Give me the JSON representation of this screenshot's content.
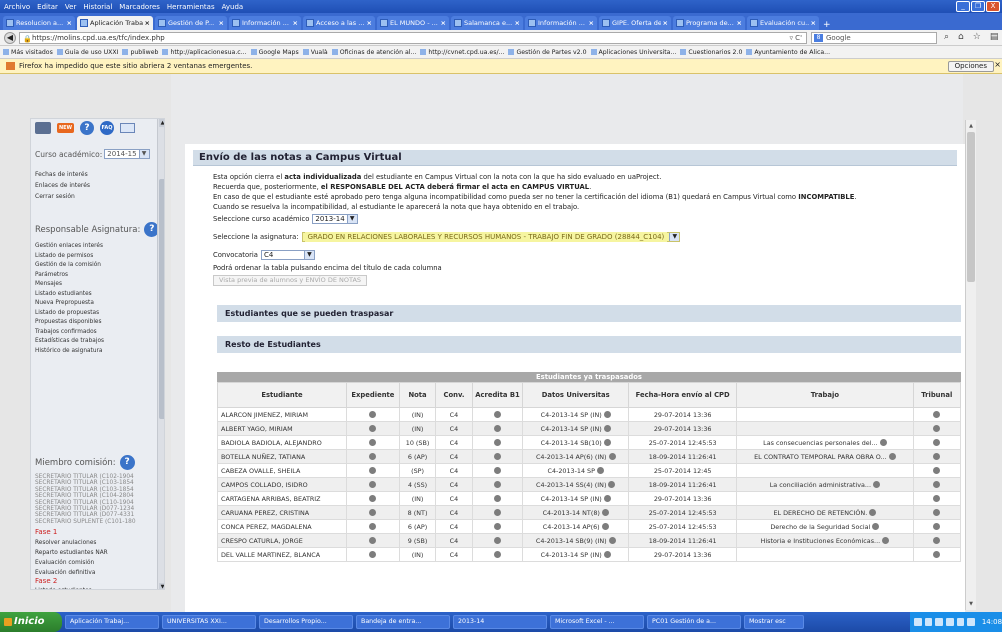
{
  "menubar": {
    "items": [
      "Archivo",
      "Editar",
      "Ver",
      "Historial",
      "Marcadores",
      "Herramientas",
      "Ayuda"
    ],
    "controls": [
      "_",
      "❐",
      "X"
    ]
  },
  "tabs": [
    "Resolucion a...",
    "Aplicación Trabaj...",
    "Gestión de P...",
    "Información ...",
    "Acceso a las ...",
    "EL MUNDO - ...",
    "Salamanca e...",
    "Información ...",
    "GIPE. Oferta de E...",
    "Programa de...",
    "Evaluación cu..."
  ],
  "urlbar": {
    "url": "https://molins.cpd.ua.es/tfc/index.php",
    "search": "Google",
    "reload": "▿ C'"
  },
  "bookmarks": [
    "Más visitados",
    "Guía de uso UXXI",
    "publiweb",
    "http://aplicacionesua.c...",
    "Google Maps",
    "Vualà",
    "Oficinas de atención al...",
    "http://cvnet.cpd.ua.es/...",
    "Gestión de Partes v2.0",
    "Aplicaciones Universita...",
    "Cuestionarios 2.0",
    "Ayuntamiento de Alica..."
  ],
  "notice": {
    "text": "Firefox ha impedido que este sitio abriera 2 ventanas emergentes.",
    "options": "Opciones"
  },
  "sidebar": {
    "icons": {
      "new": "NEW",
      "help": "?",
      "faq": "FAQ"
    },
    "curso_label": "Curso académico:",
    "curso_value": "2014-15",
    "links": [
      "Fechas de interés",
      "Enlaces de interés",
      "Cerrar sesión"
    ],
    "resp_heading": "Responsable Asignatura:",
    "resp_items": [
      "Gestión enlaces interés",
      "Listado de permisos",
      "Gestión de la comisión",
      "Parámetros",
      "Mensajes",
      "Listado estudiantes",
      "Nueva Prepropuesta",
      "Listado de propuestas",
      "Propuestas disponibles",
      "Trabajos confirmados",
      "Estadísticas de trabajos",
      "Histórico de asignatura"
    ],
    "miembro_heading": "Miembro comisión:",
    "secretarios": [
      "SECRETARIO TITULAR (C102-1904",
      "SECRETARIO TITULAR (C103-1854",
      "SECRETARIO TITULAR (C103-1854",
      "SECRETARIO TITULAR (C104-2804",
      "SECRETARIO TITULAR (C110-1904",
      "SECRETARIO TITULAR (D077-1234",
      "SECRETARIO TITULAR (D077-4331",
      "SECRETARIO SUPLENTE (C101-180"
    ],
    "fase1": "Fase 1",
    "fase1_items": [
      "Resolver anulaciones",
      "Reparto estudiantes NAR",
      "Evaluación comisión",
      "Evaluación definitiva"
    ],
    "fase2": "Fase 2",
    "fase2_items": [
      "Listado estudiantes"
    ]
  },
  "main": {
    "title": "Envío de las notas a Campus Virtual",
    "intro": [
      [
        "Esta opción cierra el ",
        "acta individualizada",
        " del estudiante en Campus Virtual con la nota con la que ha sido evaluado en uaProject."
      ],
      [
        "Recuerda que, posteriormente, ",
        "el RESPONSABLE DEL ACTA deberá firmar el acta en CAMPUS VIRTUAL",
        "."
      ],
      [
        "En caso de que el estudiante esté aprobado pero tenga alguna incompatibilidad como pueda ser no tener la certificación del idioma (B1) quedará en Campus Virtual como ",
        "INCOMPATIBLE",
        "."
      ],
      [
        "Cuando se resuelva la incompatibilidad, al estudiante le aparecerá la nota que haya obtenido en el trabajo.",
        "",
        ""
      ]
    ],
    "curso_label": "Seleccione curso académico",
    "curso_value": "2013-14",
    "asignatura_label": "Seleccione la asignatura:",
    "asignatura_value": "GRADO EN RELACIONES LABORALES Y RECURSOS HUMANOS - TRABAJO FIN DE GRADO (28844_C104)",
    "conv_label": "Convocatoria",
    "conv_value": "C4",
    "orden_text": "Podrá ordenar la tabla pulsando encima del título de cada columna",
    "preview_button": "Vista previa de alumnos y ENVÍO DE NOTAS",
    "band1": "Estudiantes que se pueden traspasar",
    "band2": "Resto de Estudiantes",
    "table": {
      "caption": "Estudiantes ya traspasados",
      "headers": [
        "Estudiante",
        "Expediente",
        "Nota",
        "Conv.",
        "Acredita B1",
        "Datos Universitas",
        "Fecha-Hora envío al CPD",
        "Trabajo",
        "Tribunal"
      ],
      "rows": [
        {
          "name": "ALARCON JIMENEZ, MIRIAM",
          "nota": "(IN)",
          "conv": "C4",
          "datos": "C4-2013-14 SP (IN)",
          "fecha": "29-07-2014 13:36",
          "trabajo": ""
        },
        {
          "name": "ALBERT YAGO, MIRIAM",
          "nota": "(IN)",
          "conv": "C4",
          "datos": "C4-2013-14 SP (IN)",
          "fecha": "29-07-2014 13:36",
          "trabajo": ""
        },
        {
          "name": "BADIOLA BADIOLA, ALEJANDRO",
          "nota": "10 (SB)",
          "conv": "C4",
          "datos": "C4-2013-14 SB(10)",
          "fecha": "25-07-2014 12:45:53",
          "trabajo": "Las consecuencias personales del..."
        },
        {
          "name": "BOTELLA NUÑEZ, TATIANA",
          "nota": "6 (AP)",
          "conv": "C4",
          "datos": "C4-2013-14 AP(6) (IN)",
          "fecha": "18-09-2014 11:26:41",
          "trabajo": "EL CONTRATO TEMPORAL PARA OBRA O..."
        },
        {
          "name": "CABEZA OVALLE, SHEILA",
          "nota": "(SP)",
          "conv": "C4",
          "datos": "C4-2013-14 SP",
          "fecha": "25-07-2014 12:45",
          "trabajo": ""
        },
        {
          "name": "CAMPOS COLLADO, ISIDRO",
          "nota": "4 (SS)",
          "conv": "C4",
          "datos": "C4-2013-14 SS(4) (IN)",
          "fecha": "18-09-2014 11:26:41",
          "trabajo": "La conciliación administrativa..."
        },
        {
          "name": "CARTAGENA ARRIBAS, BEATRIZ",
          "nota": "(IN)",
          "conv": "C4",
          "datos": "C4-2013-14 SP (IN)",
          "fecha": "29-07-2014 13:36",
          "trabajo": ""
        },
        {
          "name": "CARUANA PEREZ, CRISTINA",
          "nota": "8 (NT)",
          "conv": "C4",
          "datos": "C4-2013-14 NT(8)",
          "fecha": "25-07-2014 12:45:53",
          "trabajo": "EL DERECHO DE RETENCIÓN."
        },
        {
          "name": "CONCA PEREZ, MAGDALENA",
          "nota": "6 (AP)",
          "conv": "C4",
          "datos": "C4-2013-14 AP(6)",
          "fecha": "25-07-2014 12:45:53",
          "trabajo": "Derecho de la Seguridad Social"
        },
        {
          "name": "CRESPO CATURLA, JORGE",
          "nota": "9 (SB)",
          "conv": "C4",
          "datos": "C4-2013-14 SB(9) (IN)",
          "fecha": "18-09-2014 11:26:41",
          "trabajo": "Historia e Instituciones Económicas..."
        },
        {
          "name": "DEL VALLE MARTINEZ, BLANCA",
          "nota": "(IN)",
          "conv": "C4",
          "datos": "C4-2013-14 SP (IN)",
          "fecha": "29-07-2014 13:36",
          "trabajo": ""
        }
      ]
    }
  },
  "taskbar": {
    "start": "Inicio",
    "items": [
      "Aplicación Trabaj...",
      "UNIVERSITAS XXI...",
      "Desarrollos Propio...",
      "Bandeja de entra...",
      "2013-14",
      "Microsoft Excel - ...",
      "PC01 Gestión de a...",
      "Mostrar esc"
    ],
    "clock": "14:08"
  }
}
